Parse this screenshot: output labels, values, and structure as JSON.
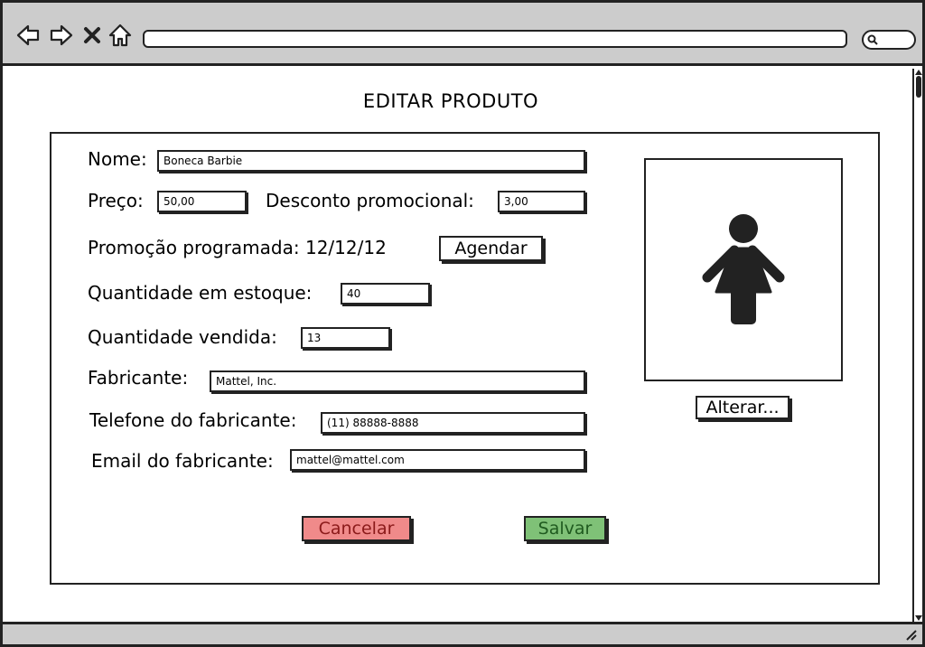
{
  "browser": {
    "url": "",
    "search_placeholder": ""
  },
  "page": {
    "title": "EDITAR PRODUTO"
  },
  "form": {
    "nome_label": "Nome:",
    "nome_value": "Boneca Barbie",
    "preco_label": "Preço:",
    "preco_value": "50,00",
    "desconto_label": "Desconto promocional:",
    "desconto_value": "3,00",
    "promocao_label": "Promoção programada: 12/12/12",
    "agendar_button": "Agendar",
    "estoque_label": "Quantidade em estoque:",
    "estoque_value": "40",
    "vendida_label": "Quantidade vendida:",
    "vendida_value": "13",
    "fabricante_label": "Fabricante:",
    "fabricante_value": "Mattel, Inc.",
    "telefone_label": "Telefone do fabricante:",
    "telefone_value": "(11) 88888-8888",
    "email_label": "Email do fabricante:",
    "email_value": "mattel@mattel.com"
  },
  "image": {
    "icon": "female-person-icon",
    "alterar_button": "Alterar..."
  },
  "actions": {
    "cancel": "Cancelar",
    "save": "Salvar"
  },
  "colors": {
    "cancel_bg": "#f08a8a",
    "save_bg": "#7fc177",
    "chrome_gray": "#cccccc"
  }
}
